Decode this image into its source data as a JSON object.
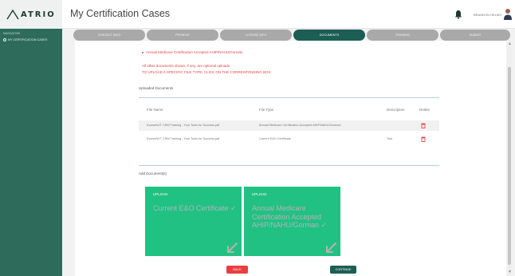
{
  "brand": {
    "logo_text": "ATRIO",
    "accent": "#1d5e54",
    "sidebar_color": "#2e6b5a",
    "upload_color": "#21c183"
  },
  "sidebar": {
    "caption": "Navigation",
    "items": [
      {
        "label": "My Certification Cases",
        "icon": "circle-icon"
      }
    ]
  },
  "header": {
    "title": "My Certification Cases",
    "user_name": "BRANDON HELMS",
    "icons": [
      "bell-icon",
      "avatar-icon"
    ]
  },
  "tabs": [
    {
      "label": "Contact Info",
      "active": false
    },
    {
      "label": "Payment",
      "active": false
    },
    {
      "label": "License Info",
      "active": false
    },
    {
      "label": "Documents",
      "active": true
    },
    {
      "label": "Training",
      "active": false
    },
    {
      "label": "Submit",
      "active": false
    }
  ],
  "notices": {
    "bullet": "Annual Medicare Certification Accepted AHIP/NAHU/Gorman",
    "line1": "All other documents shown, if any, are optional uploads.",
    "line2": "TO UPLOAD A SPECIFIC FILE TYPE, CLICK ON THE CORRESPONDING BOX."
  },
  "uploaded": {
    "title": "Uploaded Documents",
    "columns": [
      "File Name",
      "File Type",
      "Description",
      "Delete"
    ],
    "rows": [
      {
        "file_name": "EvolveNXT CRM Training - Your Tools for Success.pdf",
        "file_type": "Annual Medicare Certification Accepted AHIP/NAHU/Gorman",
        "description": ""
      },
      {
        "file_name": "EvolveNXT CRM Training - Your Tools for Success.pdf",
        "file_type": "Current E&O Certificate",
        "description": "Test"
      }
    ]
  },
  "add_documents": {
    "title": "Add Document(s)",
    "boxes": [
      {
        "label": "Upload",
        "doc": "Current E&O Certificate ✓"
      },
      {
        "label": "Upload",
        "doc": "Annual Medicare Certification Accepted AHIP/NAHU/Gorman ✓"
      }
    ]
  },
  "buttons": {
    "back": "Back",
    "continue": "Continue"
  }
}
